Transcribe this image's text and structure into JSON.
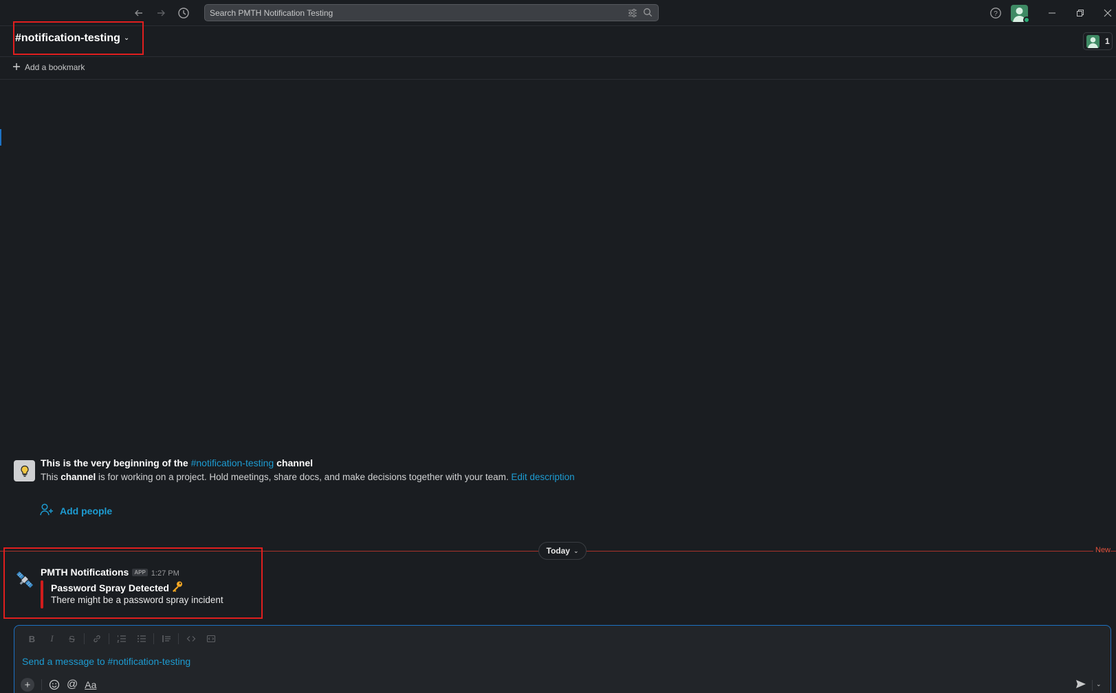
{
  "toolbar": {
    "back_label": "←",
    "forward_label": "→",
    "search_placeholder": "Search PMTH Notification Testing"
  },
  "channel": {
    "name": "notification-testing",
    "hash": "#",
    "member_count": "1",
    "add_bookmark": "Add a bookmark"
  },
  "intro": {
    "prefix": "This is the very beginning of the ",
    "channel_link": "#notification-testing",
    "suffix": " channel",
    "desc_prefix": "This ",
    "desc_bold": "channel",
    "desc_rest": " is for working on a project. Hold meetings, share docs, and make decisions together with your team. ",
    "edit_link": "Edit description",
    "add_people": "Add people"
  },
  "divider": {
    "label": "Today",
    "new_label": "New"
  },
  "message": {
    "sender": "PMTH Notifications",
    "badge": "APP",
    "time": "1:27 PM",
    "title": "Password Spray Detected",
    "title_emoji": "🔑",
    "body": "There might be a password spray incident"
  },
  "composer": {
    "placeholder": "Send a message to #notification-testing",
    "format_label": "Aa",
    "mention_label": "@"
  },
  "colors": {
    "background": "#1a1d21",
    "link": "#1d9bd1",
    "highlight_box": "#e01e1e",
    "new_line": "#a8322a",
    "attachment_bar": "#d11c1c",
    "presence": "#2bac76"
  }
}
